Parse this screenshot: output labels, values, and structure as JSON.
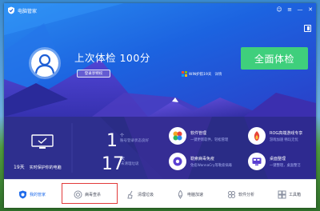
{
  "app": {
    "title": "电脑管家"
  },
  "titlebar": {
    "controls": [
      "☺",
      "≡",
      "—",
      "✕"
    ]
  },
  "hero": {
    "last_check": "上次体检 100分",
    "login_label": "登录享特权",
    "full_check_label": "全面体检",
    "pc_status_main": "WIN护航19天",
    "pc_status_link": "详情"
  },
  "panel": {
    "protect": {
      "days": "19天",
      "label": "实时保护你的电脑"
    },
    "stats": [
      {
        "num": "1",
        "unit": "个",
        "desc": "账号登录状态良好"
      },
      {
        "num": "17",
        "unit": "天",
        "desc": "未清理垃圾"
      }
    ],
    "features": [
      {
        "title": "软件管理",
        "sub": "一键更新软件，轻松管理",
        "icon": "software-manager-icon"
      },
      {
        "title": "勒索病毒免疫",
        "sub": "免疫WannaCry等勒索病毒",
        "icon": "ransomware-shield-icon"
      },
      {
        "title": "ROG高端游戏专享",
        "sub": "游戏加速 畅玩无忧",
        "icon": "game-boost-icon"
      },
      {
        "title": "桌面整理",
        "sub": "一键整理，桌面整洁",
        "icon": "desktop-organize-icon"
      }
    ]
  },
  "nav": {
    "items": [
      {
        "label": "我的管家",
        "icon": "home-icon",
        "active": true
      },
      {
        "label": "病毒查杀",
        "icon": "virus-scan-icon",
        "active": false
      },
      {
        "label": "清理垃圾",
        "icon": "broom-icon",
        "active": false
      },
      {
        "label": "电脑加速",
        "icon": "rocket-icon",
        "active": false
      },
      {
        "label": "软件分析",
        "icon": "software-analysis-icon",
        "active": false
      },
      {
        "label": "工具箱",
        "icon": "toolbox-icon",
        "active": false
      }
    ]
  },
  "colors": {
    "accent": "#1f6bea",
    "green_button": "#3fcf7c",
    "panel": "#2a2c86",
    "highlight": "#e23a3a"
  }
}
